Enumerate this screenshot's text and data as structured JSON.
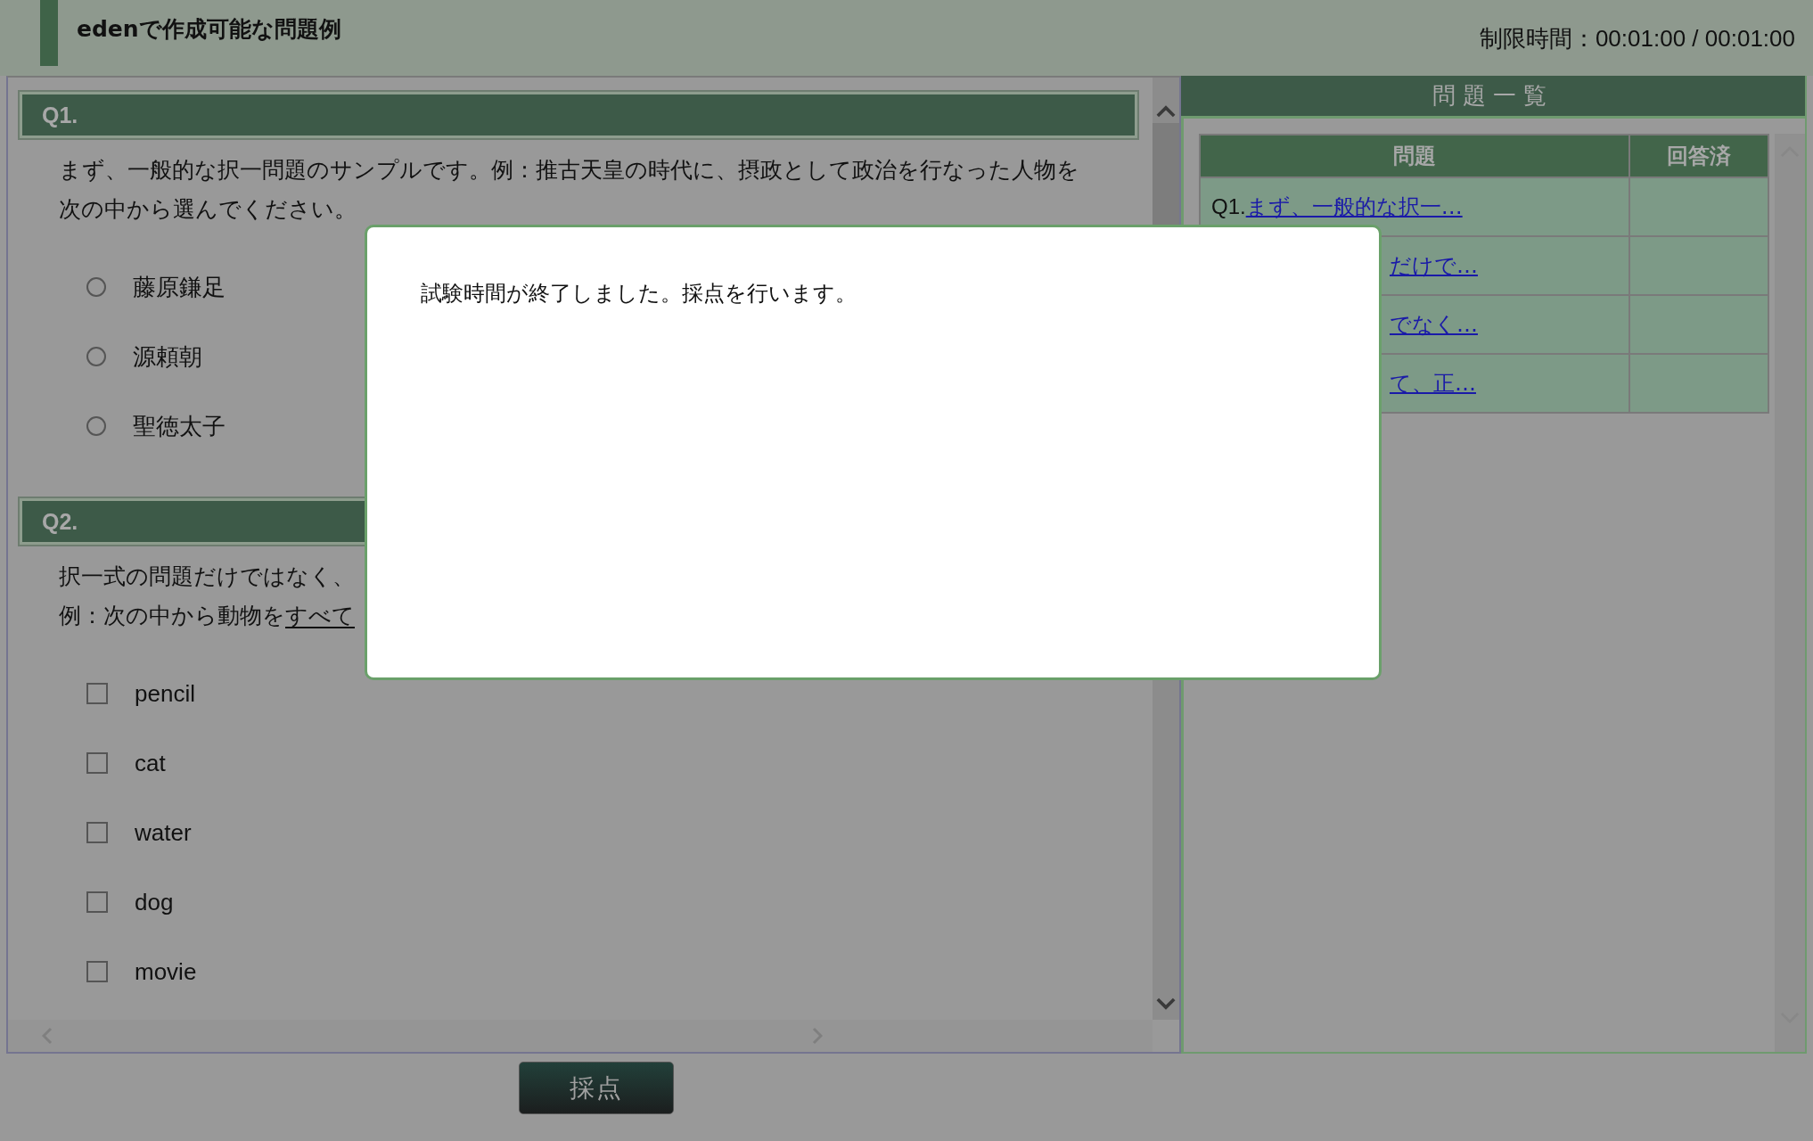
{
  "header": {
    "title": "edenで作成可能な問題例",
    "timer": "制限時間：00:01:00 / 00:01:00"
  },
  "questions": [
    {
      "label": "Q1.",
      "kind": "radio",
      "lines": [
        [
          {
            "text": "まず、一般的な択一問題のサンプルです。例：推古天皇の時代に、摂政として政治を行なった人物を",
            "underline": false
          }
        ],
        [
          {
            "text": "次の中から選んでください。",
            "underline": false
          }
        ]
      ],
      "options": [
        {
          "label": "藤原鎌足",
          "selected": false
        },
        {
          "label": "源頼朝",
          "selected": false
        },
        {
          "label": "聖徳太子",
          "selected": false
        }
      ]
    },
    {
      "label": "Q2.",
      "kind": "checkbox",
      "lines": [
        [
          {
            "text": "択一式の問題だけではなく、",
            "underline": false
          }
        ],
        [
          {
            "text": "例：次の中から動物を",
            "underline": false
          },
          {
            "text": "すべて",
            "underline": true
          }
        ]
      ],
      "options": [
        {
          "label": "pencil",
          "checked": false
        },
        {
          "label": "cat",
          "checked": false
        },
        {
          "label": "water",
          "checked": false
        },
        {
          "label": "dog",
          "checked": false
        },
        {
          "label": "movie",
          "checked": false
        }
      ]
    }
  ],
  "sidebar": {
    "title": "問題一覧",
    "columns": [
      "問題",
      "回答済"
    ],
    "rows": [
      {
        "prefix": "Q1.",
        "link": "まず、一般的な択一…",
        "hidden_start": false
      },
      {
        "prefix": "",
        "link": "だけで…",
        "hidden_start": true
      },
      {
        "prefix": "",
        "link": "でなく…",
        "hidden_start": true
      },
      {
        "prefix": "",
        "link": "て、正…",
        "hidden_start": true
      }
    ]
  },
  "submit_button": "採点",
  "dialog": {
    "message": "試験時間が終了しました。採点を行います。"
  }
}
